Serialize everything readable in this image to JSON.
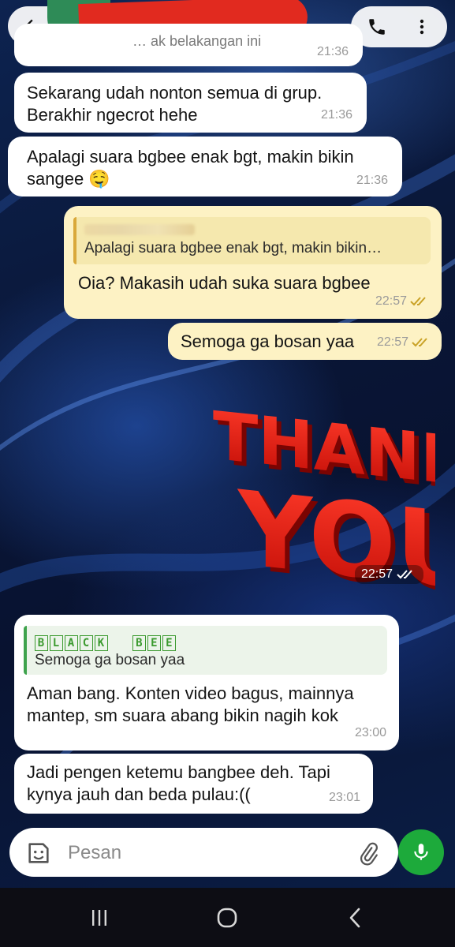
{
  "messages": [
    {
      "text": "… ak belakangan ini",
      "time": "21:36"
    },
    {
      "text": "Sekarang udah nonton semua di grup. Berakhir ngecrot hehe",
      "time": "21:36"
    },
    {
      "text": "Apalagi suara bgbee enak bgt, makin bikin sangee 🤤",
      "time": "21:36"
    },
    {
      "quote_text": "Apalagi suara bgbee enak bgt, makin bikin…",
      "text": "Oia? Makasih udah suka suara bgbee",
      "time": "22:57"
    },
    {
      "text": "Semoga ga bosan yaa",
      "time": "22:57"
    },
    {
      "sticker_line1": "THANK",
      "sticker_line2": "YOU",
      "time": "22:57"
    },
    {
      "quote_author_letters": [
        "B",
        "L",
        "A",
        "C",
        "K"
      ],
      "quote_author_letters2": [
        "B",
        "E",
        "E"
      ],
      "quote_text": "Semoga ga bosan yaa",
      "text": "Aman bang. Konten video bagus, mainnya mantep, sm suara abang bikin nagih kok",
      "time": "23:00"
    },
    {
      "text": "Jadi pengen ketemu bangbee deh. Tapi kynya jauh dan beda pulau:((",
      "time": "23:01"
    }
  ],
  "input": {
    "placeholder": "Pesan"
  },
  "colors": {
    "outgoing_bubble": "#fdf2c4",
    "incoming_bubble": "#ffffff",
    "mic_green": "#1daa3b",
    "read_tick": "#c9a227"
  },
  "icons": [
    "back-arrow-icon",
    "phone-icon",
    "more-vertical-icon",
    "sticker-icon",
    "paperclip-icon",
    "mic-icon",
    "recents-icon",
    "home-icon",
    "nav-back-icon"
  ]
}
